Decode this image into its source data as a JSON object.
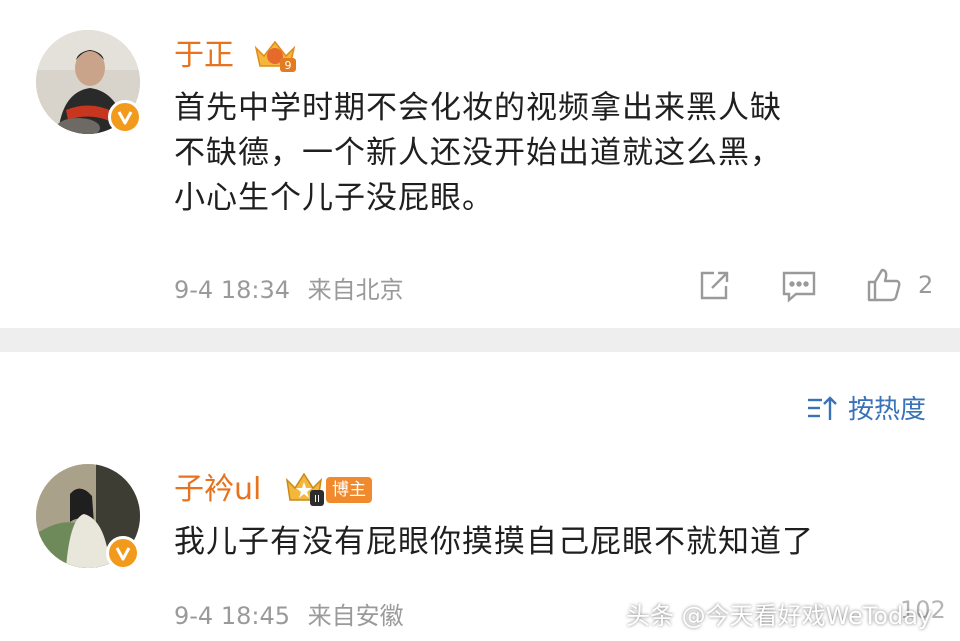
{
  "comments": [
    {
      "username": "于正",
      "rank": "9",
      "text_lines": [
        "首先中学时期不会化妆的视频拿出来黑人缺",
        "不缺德，一个新人还没开始出道就这么黑，",
        "小心生个儿子没屁眼。"
      ],
      "time": "9-4 18:34",
      "location": "来自北京",
      "like_count": "2",
      "icons": [
        "share-icon",
        "comment-icon",
        "like-icon"
      ]
    },
    {
      "username": "子衿ul",
      "rank": "II",
      "badge": "博主",
      "text_lines": [
        "我儿子有没有屁眼你摸摸自己屁眼不就知道了"
      ],
      "time": "9-4 18:45",
      "location": "来自安徽",
      "like_count": "102"
    }
  ],
  "sort": {
    "label": "按热度"
  },
  "watermark": "头条 @今天看好戏WeToday",
  "colors": {
    "username": "#e8731e",
    "link": "#3a72b8",
    "vip": "#f29a1b",
    "meta": "#9a9a9a"
  }
}
